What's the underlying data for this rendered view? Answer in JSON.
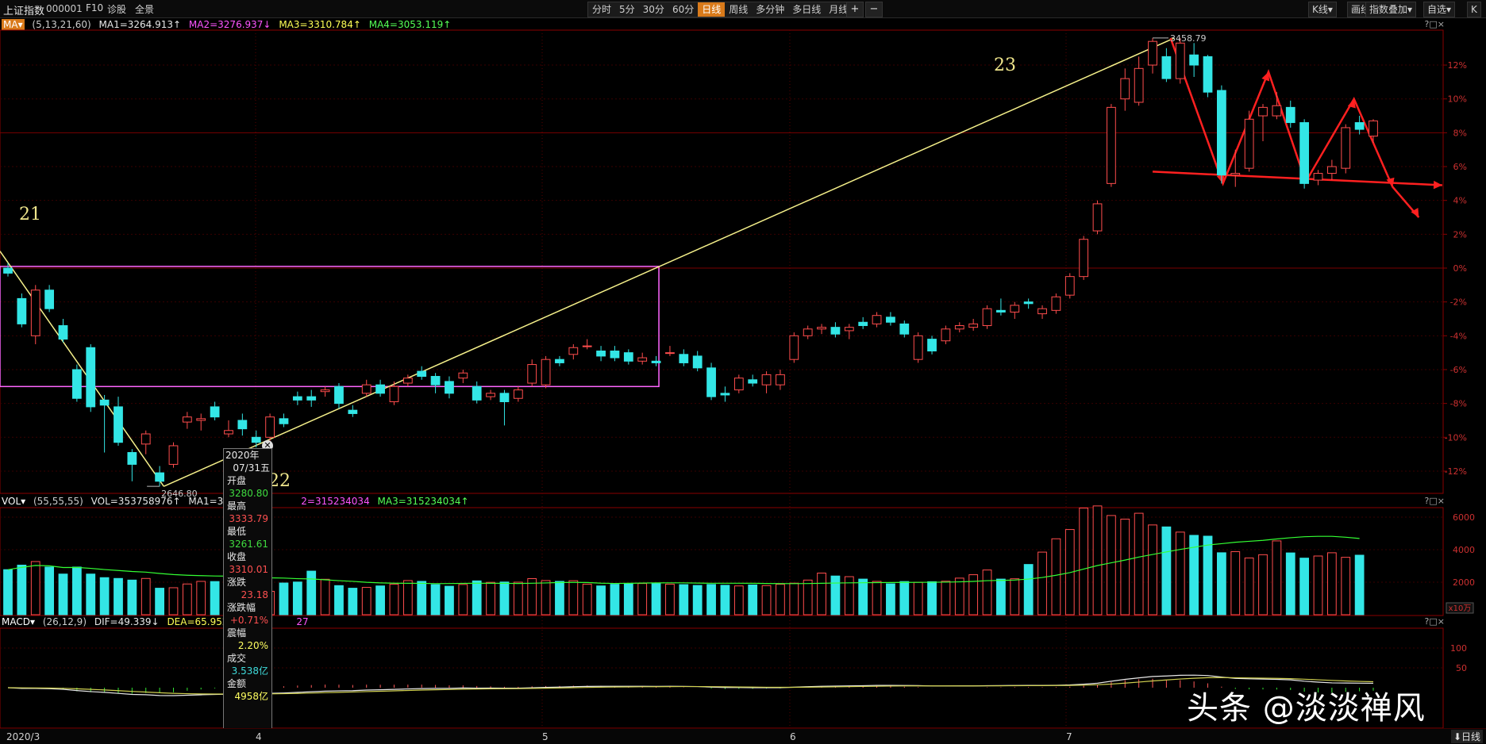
{
  "header": {
    "title": "上证指数",
    "code": "000001",
    "menu": [
      "F10",
      "诊股",
      "全景"
    ],
    "periods": [
      "分时",
      "5分",
      "30分",
      "60分",
      "日线",
      "周线",
      "多分钟",
      "多日线",
      "月线▾"
    ],
    "active_period": "日线",
    "zoom_in": "+",
    "zoom_out": "−",
    "right_tools": [
      "K线▾",
      "画线",
      "指数叠加▾",
      "自选▾",
      "K"
    ]
  },
  "ma_legend": {
    "label": "MA▾",
    "params": "(5,13,21,60)",
    "ma1": "MA1=3264.913↑",
    "ma2": "MA2=3276.937↓",
    "ma3": "MA3=3310.784↑",
    "ma4": "MA4=3053.119↑"
  },
  "vol_legend": {
    "label": "VOL▾",
    "params": "(55,55,55)",
    "vol": "VOL=353758976↑",
    "ma1": "MA1=315234",
    "ma2": "2=315234034",
    "ma3": "MA3=315234034↑"
  },
  "macd_legend": {
    "label": "MACD▾",
    "params": "(26,12,9)",
    "dif": "DIF=49.339↓",
    "dea": "DEA=65.952↓",
    "macd": "27"
  },
  "panel_icons": "?□×",
  "tooltip": {
    "year": "2020年",
    "date": "07/31五",
    "rows": [
      {
        "label": "开盘",
        "value": "3280.80",
        "color": "#3fdc3f"
      },
      {
        "label": "最高",
        "value": "3333.79",
        "color": "#ff5050"
      },
      {
        "label": "最低",
        "value": "3261.61",
        "color": "#3fdc3f"
      },
      {
        "label": "收盘",
        "value": "3310.01",
        "color": "#ff5050"
      },
      {
        "label": "涨跌",
        "value": "23.18",
        "color": "#ff5050"
      },
      {
        "label": "涨跌幅",
        "value": "+0.71%",
        "color": "#ff5050"
      },
      {
        "label": "震幅",
        "value": "2.20%",
        "color": "#ffff60"
      },
      {
        "label": "成交",
        "value": "3.538亿",
        "color": "#3fdcdc"
      },
      {
        "label": "金额",
        "value": "4958亿",
        "color": "#ffff60"
      }
    ]
  },
  "annotations": {
    "a21": "21",
    "a22": "22",
    "a23": "23"
  },
  "watermark": "头条 @淡淡禅风",
  "date_axis": {
    "labels": [
      "2020/3",
      "4",
      "5",
      "6",
      "7"
    ],
    "bottom_right": "⬇日线"
  },
  "chart_data": [
    {
      "type": "candlestick",
      "y_axis": "percent",
      "ylim": [
        -13.5,
        14
      ],
      "yticks": [
        "12%",
        "10%",
        "8%",
        "6%",
        "4%",
        "2%",
        "0%",
        "-2%",
        "-4%",
        "-6%",
        "-8%",
        "-10%",
        "-12%"
      ],
      "annotations": {
        "high": "3458.79",
        "low": "2646.80"
      },
      "candles": [
        {
          "o": 0.0,
          "c": -0.3,
          "h": 0.3,
          "l": -0.5
        },
        {
          "o": -1.8,
          "c": -3.3,
          "h": -1.5,
          "l": -3.5
        },
        {
          "o": -4.0,
          "c": -1.3,
          "h": -1.0,
          "l": -4.5
        },
        {
          "o": -1.3,
          "c": -2.4,
          "h": -1.0,
          "l": -2.6
        },
        {
          "o": -3.4,
          "c": -4.2,
          "h": -3.0,
          "l": -4.4
        },
        {
          "o": -6.0,
          "c": -7.7,
          "h": -5.7,
          "l": -7.9
        },
        {
          "o": -4.7,
          "c": -8.2,
          "h": -4.5,
          "l": -8.5
        },
        {
          "o": -7.8,
          "c": -8.1,
          "h": -7.5,
          "l": -10.9
        },
        {
          "o": -8.2,
          "c": -10.3,
          "h": -7.6,
          "l": -10.5
        },
        {
          "o": -10.9,
          "c": -11.6,
          "h": -10.7,
          "l": -12.6
        },
        {
          "o": -10.4,
          "c": -9.8,
          "h": -9.6,
          "l": -11.0
        },
        {
          "o": -12.1,
          "c": -12.6,
          "h": -11.7,
          "l": -12.9
        },
        {
          "o": -11.6,
          "c": -10.5,
          "h": -10.3,
          "l": -11.8
        },
        {
          "o": -9.1,
          "c": -8.8,
          "h": -8.5,
          "l": -9.5
        },
        {
          "o": -9.0,
          "c": -8.9,
          "h": -8.6,
          "l": -9.6
        },
        {
          "o": -8.2,
          "c": -8.8,
          "h": -7.9,
          "l": -9.0
        },
        {
          "o": -9.8,
          "c": -9.6,
          "h": -9.0,
          "l": -10.0
        },
        {
          "o": -9.0,
          "c": -9.5,
          "h": -8.6,
          "l": -9.9
        },
        {
          "o": -10.0,
          "c": -10.3,
          "h": -9.6,
          "l": -10.6
        },
        {
          "o": -10.0,
          "c": -8.8,
          "h": -8.6,
          "l": -10.2
        },
        {
          "o": -8.9,
          "c": -9.2,
          "h": -8.6,
          "l": -9.4
        },
        {
          "o": -7.6,
          "c": -7.8,
          "h": -7.3,
          "l": -8.1
        },
        {
          "o": -7.6,
          "c": -7.8,
          "h": -7.2,
          "l": -8.2
        },
        {
          "o": -7.3,
          "c": -7.2,
          "h": -7.0,
          "l": -7.6
        },
        {
          "o": -7.0,
          "c": -8.0,
          "h": -6.8,
          "l": -8.3
        },
        {
          "o": -8.4,
          "c": -8.6,
          "h": -8.1,
          "l": -8.8
        },
        {
          "o": -7.4,
          "c": -6.9,
          "h": -6.6,
          "l": -7.6
        },
        {
          "o": -6.9,
          "c": -7.4,
          "h": -6.6,
          "l": -7.6
        },
        {
          "o": -7.9,
          "c": -7.0,
          "h": -6.7,
          "l": -8.1
        },
        {
          "o": -6.8,
          "c": -6.5,
          "h": -6.3,
          "l": -7.0
        },
        {
          "o": -6.1,
          "c": -6.4,
          "h": -5.8,
          "l": -6.6
        },
        {
          "o": -6.4,
          "c": -6.9,
          "h": -6.2,
          "l": -7.4
        },
        {
          "o": -6.7,
          "c": -7.4,
          "h": -6.4,
          "l": -7.7
        },
        {
          "o": -6.5,
          "c": -6.2,
          "h": -6.0,
          "l": -6.8
        },
        {
          "o": -7.0,
          "c": -7.8,
          "h": -6.7,
          "l": -8.0
        },
        {
          "o": -7.6,
          "c": -7.4,
          "h": -7.2,
          "l": -7.8
        },
        {
          "o": -7.4,
          "c": -7.9,
          "h": -7.2,
          "l": -9.3
        },
        {
          "o": -7.7,
          "c": -7.2,
          "h": -7.0,
          "l": -7.9
        },
        {
          "o": -6.8,
          "c": -5.7,
          "h": -5.4,
          "l": -7.0
        },
        {
          "o": -6.9,
          "c": -5.4,
          "h": -5.2,
          "l": -7.1
        },
        {
          "o": -5.4,
          "c": -5.6,
          "h": -5.2,
          "l": -5.8
        },
        {
          "o": -5.1,
          "c": -4.7,
          "h": -4.5,
          "l": -5.4
        },
        {
          "o": -4.6,
          "c": -4.6,
          "h": -4.2,
          "l": -4.8
        },
        {
          "o": -4.9,
          "c": -5.2,
          "h": -4.6,
          "l": -5.5
        },
        {
          "o": -4.9,
          "c": -5.3,
          "h": -4.6,
          "l": -5.5
        },
        {
          "o": -5.0,
          "c": -5.5,
          "h": -4.8,
          "l": -5.7
        },
        {
          "o": -5.5,
          "c": -5.3,
          "h": -5.0,
          "l": -5.7
        },
        {
          "o": -5.5,
          "c": -5.6,
          "h": -5.2,
          "l": -5.8
        },
        {
          "o": -5.0,
          "c": -5.0,
          "h": -4.6,
          "l": -5.2
        },
        {
          "o": -5.1,
          "c": -5.6,
          "h": -4.8,
          "l": -5.8
        },
        {
          "o": -5.2,
          "c": -5.9,
          "h": -4.9,
          "l": -6.1
        },
        {
          "o": -5.9,
          "c": -7.6,
          "h": -5.6,
          "l": -7.8
        },
        {
          "o": -7.4,
          "c": -7.5,
          "h": -7.0,
          "l": -7.9
        },
        {
          "o": -7.2,
          "c": -6.5,
          "h": -6.3,
          "l": -7.4
        },
        {
          "o": -6.6,
          "c": -6.8,
          "h": -6.3,
          "l": -7.0
        },
        {
          "o": -6.9,
          "c": -6.3,
          "h": -6.1,
          "l": -7.4
        },
        {
          "o": -6.9,
          "c": -6.3,
          "h": -6.0,
          "l": -7.2
        },
        {
          "o": -5.4,
          "c": -4.0,
          "h": -3.8,
          "l": -5.6
        },
        {
          "o": -4.0,
          "c": -3.6,
          "h": -3.4,
          "l": -4.2
        },
        {
          "o": -3.6,
          "c": -3.5,
          "h": -3.3,
          "l": -3.9
        },
        {
          "o": -3.5,
          "c": -3.9,
          "h": -3.2,
          "l": -4.1
        },
        {
          "o": -3.7,
          "c": -3.5,
          "h": -3.3,
          "l": -4.2
        },
        {
          "o": -3.2,
          "c": -3.4,
          "h": -2.9,
          "l": -3.6
        },
        {
          "o": -3.3,
          "c": -2.8,
          "h": -2.6,
          "l": -3.5
        },
        {
          "o": -2.9,
          "c": -3.2,
          "h": -2.6,
          "l": -3.4
        },
        {
          "o": -3.3,
          "c": -3.9,
          "h": -3.1,
          "l": -4.1
        },
        {
          "o": -5.4,
          "c": -4.0,
          "h": -3.8,
          "l": -5.6
        },
        {
          "o": -4.2,
          "c": -4.9,
          "h": -4.0,
          "l": -5.1
        },
        {
          "o": -4.3,
          "c": -3.6,
          "h": -3.4,
          "l": -4.5
        },
        {
          "o": -3.6,
          "c": -3.4,
          "h": -3.2,
          "l": -3.8
        },
        {
          "o": -3.5,
          "c": -3.3,
          "h": -3.0,
          "l": -3.7
        },
        {
          "o": -3.4,
          "c": -2.4,
          "h": -2.2,
          "l": -3.6
        },
        {
          "o": -2.5,
          "c": -2.6,
          "h": -1.8,
          "l": -2.8
        },
        {
          "o": -2.6,
          "c": -2.2,
          "h": -2.0,
          "l": -3.0
        },
        {
          "o": -2.0,
          "c": -2.1,
          "h": -1.8,
          "l": -2.4
        },
        {
          "o": -2.7,
          "c": -2.4,
          "h": -2.2,
          "l": -3.0
        },
        {
          "o": -2.5,
          "c": -1.7,
          "h": -1.5,
          "l": -2.7
        },
        {
          "o": -1.6,
          "c": -0.5,
          "h": -0.3,
          "l": -1.8
        },
        {
          "o": -0.5,
          "c": 1.7,
          "h": 1.9,
          "l": -0.7
        },
        {
          "o": 2.2,
          "c": 3.8,
          "h": 4.0,
          "l": 2.0
        },
        {
          "o": 5.0,
          "c": 9.5,
          "h": 9.7,
          "l": 4.8
        },
        {
          "o": 10.0,
          "c": 11.2,
          "h": 11.8,
          "l": 9.3
        },
        {
          "o": 9.8,
          "c": 11.8,
          "h": 12.5,
          "l": 9.6
        },
        {
          "o": 12.0,
          "c": 13.4,
          "h": 13.6,
          "l": 11.5
        },
        {
          "o": 12.5,
          "c": 11.2,
          "h": 13.0,
          "l": 11.0
        },
        {
          "o": 11.2,
          "c": 13.3,
          "h": 13.6,
          "l": 10.9
        },
        {
          "o": 12.6,
          "c": 12.0,
          "h": 13.3,
          "l": 11.3
        },
        {
          "o": 12.5,
          "c": 10.4,
          "h": 12.6,
          "l": 10.1
        },
        {
          "o": 10.5,
          "c": 5.5,
          "h": 10.8,
          "l": 5.0
        },
        {
          "o": 5.5,
          "c": 5.6,
          "h": 7.0,
          "l": 4.8
        },
        {
          "o": 5.9,
          "c": 8.8,
          "h": 9.3,
          "l": 5.7
        },
        {
          "o": 9.0,
          "c": 9.5,
          "h": 9.7,
          "l": 7.5
        },
        {
          "o": 9.0,
          "c": 9.6,
          "h": 10.4,
          "l": 8.8
        },
        {
          "o": 9.5,
          "c": 8.6,
          "h": 9.9,
          "l": 8.3
        },
        {
          "o": 8.6,
          "c": 5.0,
          "h": 8.8,
          "l": 4.7
        },
        {
          "o": 5.2,
          "c": 5.6,
          "h": 5.8,
          "l": 4.9
        },
        {
          "o": 5.6,
          "c": 6.0,
          "h": 6.4,
          "l": 5.2
        },
        {
          "o": 5.9,
          "c": 8.3,
          "h": 8.5,
          "l": 5.6
        },
        {
          "o": 8.6,
          "c": 8.2,
          "h": 9.0,
          "l": 7.9
        },
        {
          "o": 7.8,
          "c": 8.7,
          "h": 8.8,
          "l": 7.4
        }
      ]
    },
    {
      "type": "bar",
      "title": "VOL",
      "ylim": [
        0,
        6500
      ],
      "yticks": [
        "6000",
        "4000",
        "2000"
      ],
      "unit_badge": "x10万",
      "values": [
        2770,
        3050,
        3270,
        2930,
        2500,
        2930,
        2500,
        2280,
        2230,
        2130,
        2230,
        1630,
        1660,
        1890,
        2050,
        2040,
        2230,
        1860,
        1760,
        1440,
        1950,
        2010,
        2680,
        2180,
        1790,
        1630,
        1680,
        1770,
        1880,
        2100,
        2050,
        1850,
        1750,
        1860,
        2080,
        1990,
        2010,
        2000,
        2220,
        2100,
        2050,
        2090,
        1880,
        1770,
        1870,
        1930,
        1920,
        1910,
        1880,
        1850,
        1800,
        1860,
        1810,
        1770,
        1830,
        1790,
        1870,
        1940,
        2130,
        2560,
        2380,
        2340,
        2190,
        2050,
        1900,
        2040,
        1990,
        2030,
        2060,
        2250,
        2460,
        2750,
        2190,
        2210,
        3090,
        3850,
        4670,
        5240,
        6560,
        6690,
        6100,
        5880,
        6240,
        5520,
        5400,
        5080,
        4880,
        4830,
        3810,
        3880,
        3490,
        3690,
        4540,
        3800,
        3480,
        3610,
        3810,
        3530,
        3660
      ]
    },
    {
      "type": "line",
      "title": "MACD",
      "ylim": [
        -40,
        135
      ],
      "yticks": [
        "100",
        "50"
      ]
    }
  ]
}
